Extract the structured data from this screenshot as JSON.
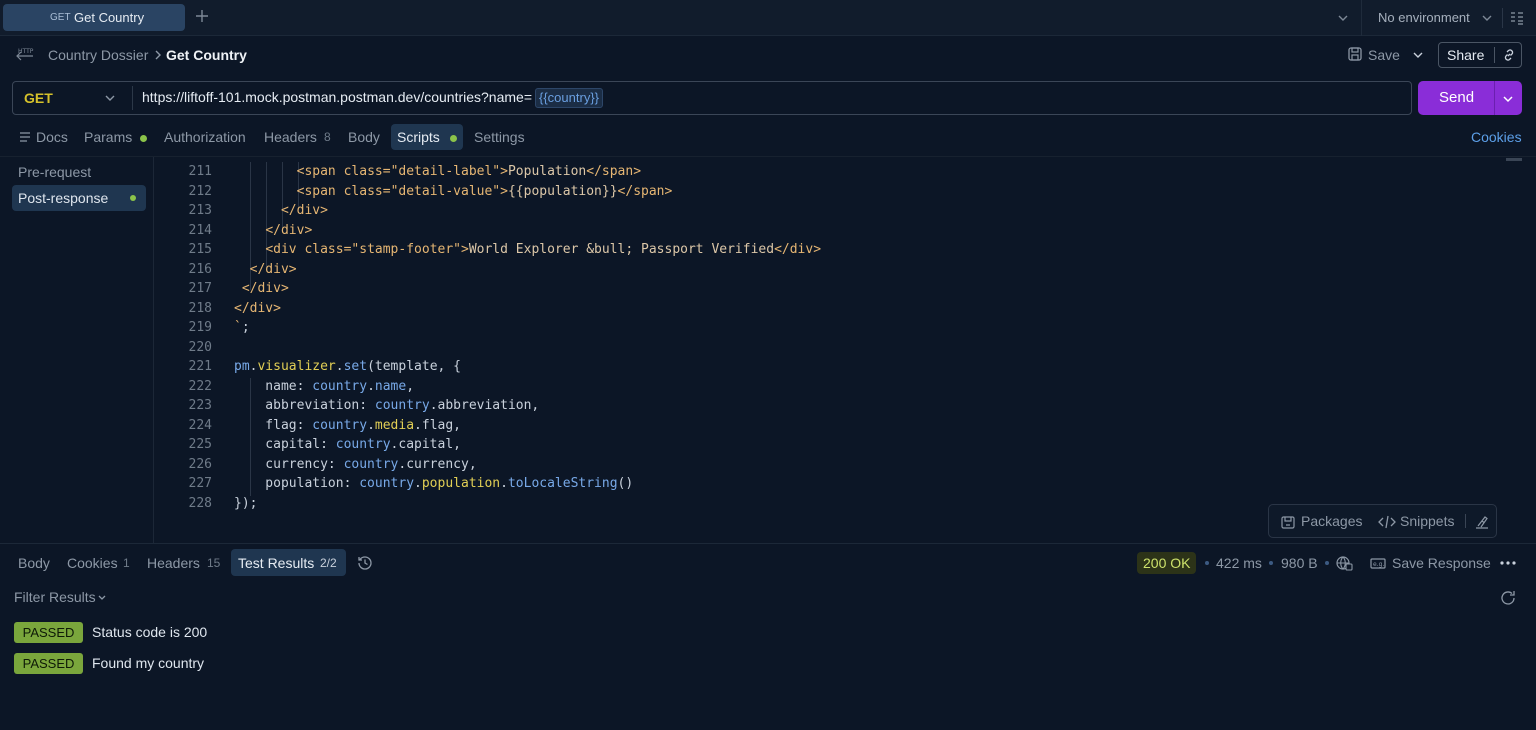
{
  "tab": {
    "method": "GET",
    "name": "Get Country"
  },
  "environment": {
    "label": "No environment"
  },
  "breadcrumb": {
    "parent": "Country Dossier",
    "current": "Get Country"
  },
  "header": {
    "save_label": "Save",
    "share_label": "Share"
  },
  "request": {
    "method": "GET",
    "url": "https://liftoff-101.mock.postman.postman.dev/countries?name=",
    "url_variable": "{{country}}",
    "send_label": "Send"
  },
  "request_tabs": {
    "docs": "Docs",
    "params": "Params",
    "authorization": "Authorization",
    "headers": "Headers",
    "headers_count": "8",
    "body": "Body",
    "scripts": "Scripts",
    "settings": "Settings",
    "cookies": "Cookies"
  },
  "script_sections": {
    "pre_request": "Pre-request",
    "post_response": "Post-response"
  },
  "code_lines": {
    "n211": "211",
    "n212": "212",
    "n213": "213",
    "n214": "214",
    "n215": "215",
    "n216": "216",
    "n217": "217",
    "n218": "218",
    "n219": "219",
    "n220": "220",
    "n221": "221",
    "n222": "222",
    "n223": "223",
    "n224": "224",
    "n225": "225",
    "n226": "226",
    "n227": "227",
    "n228": "228"
  },
  "tools": {
    "packages": "Packages",
    "snippets": "Snippets"
  },
  "response_tabs": {
    "body": "Body",
    "cookies": "Cookies",
    "cookies_count": "1",
    "headers": "Headers",
    "headers_count": "15",
    "test_results": "Test Results",
    "test_results_count": "2/2"
  },
  "response_meta": {
    "status": "200 OK",
    "time": "422 ms",
    "size": "980 B",
    "save_response": "Save Response"
  },
  "filter": {
    "label": "Filter Results"
  },
  "tests": [
    {
      "status": "PASSED",
      "name": "Status code is 200"
    },
    {
      "status": "PASSED",
      "name": "Found my country"
    }
  ],
  "colors": {
    "accent": "#8a2dd8",
    "passed": "#7aa63c",
    "active_tab": "#1f3650",
    "link": "#5c9fe8"
  }
}
